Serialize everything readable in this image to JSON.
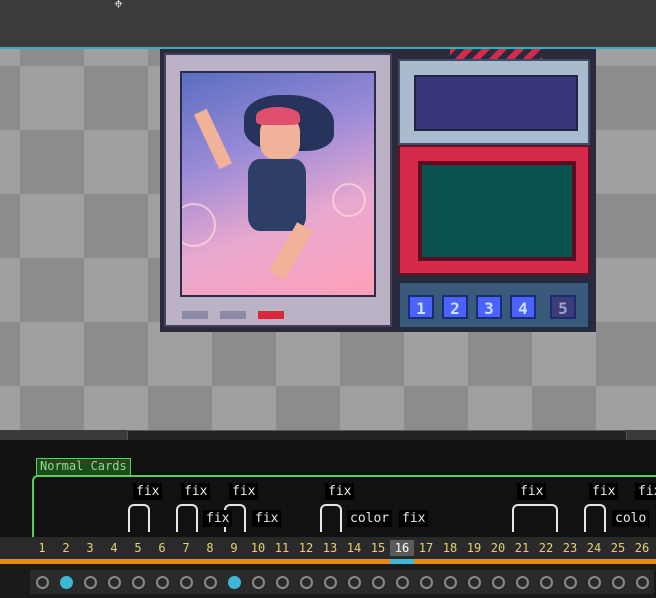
{
  "timeline": {
    "layer_name": "Normal Cards",
    "tags_row1": [
      "fix",
      "fix",
      "fix",
      "fix",
      "fix",
      "fix",
      "fix"
    ],
    "tags_row2": [
      "fix",
      "fix",
      "color",
      "fix",
      "colo"
    ],
    "frames": [
      "1",
      "2",
      "3",
      "4",
      "5",
      "6",
      "7",
      "8",
      "9",
      "10",
      "11",
      "12",
      "13",
      "14",
      "15",
      "16",
      "17",
      "18",
      "19",
      "20",
      "21",
      "22",
      "23",
      "24",
      "25",
      "26"
    ],
    "current_frame": "16",
    "keyframes": [
      2,
      9
    ]
  },
  "sprite": {
    "slot_numbers": [
      "1",
      "2",
      "3",
      "4",
      "5"
    ]
  },
  "colors": {
    "accent": "#3fa8c0",
    "layer_green": "#58d058",
    "frame_orange": "#e88a14",
    "frame_number": "#e2d36e"
  },
  "icons": {
    "cursor": "crosshair-cursor-icon",
    "keyframe": "cel-dot-icon"
  }
}
